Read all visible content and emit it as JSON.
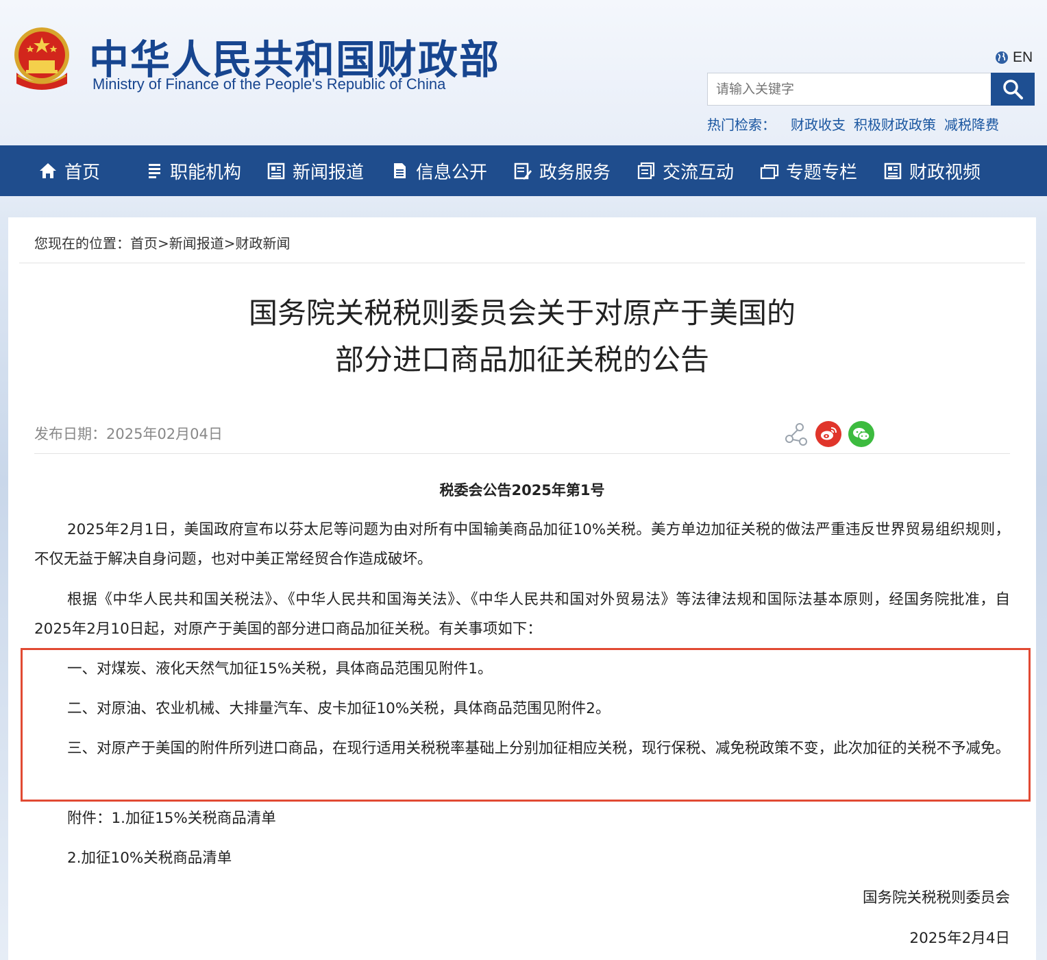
{
  "header": {
    "title_cn": "中华人民共和国财政部",
    "title_en": "Ministry of Finance of the People's Republic of China",
    "lang_label": "EN",
    "search_placeholder": "请输入关键字",
    "hot_label": "热门检索：",
    "hot_items": [
      "财政收支",
      "积极财政政策",
      "减税降费"
    ]
  },
  "nav": {
    "items": [
      {
        "label": "首页",
        "icon": "home-icon"
      },
      {
        "label": "职能机构",
        "icon": "list-icon"
      },
      {
        "label": "新闻报道",
        "icon": "news-icon"
      },
      {
        "label": "信息公开",
        "icon": "document-icon"
      },
      {
        "label": "政务服务",
        "icon": "edit-icon"
      },
      {
        "label": "交流互动",
        "icon": "chat-icon"
      },
      {
        "label": "专题专栏",
        "icon": "window-icon"
      },
      {
        "label": "财政视频",
        "icon": "video-icon"
      }
    ]
  },
  "breadcrumb": {
    "prefix": "您现在的位置：",
    "items": [
      "首页",
      "新闻报道",
      "财政新闻"
    ],
    "sep": ">"
  },
  "article": {
    "title_line1": "国务院关税税则委员会关于对原产于美国的",
    "title_line2": "部分进口商品加征关税的公告",
    "pubdate": "发布日期：2025年02月04日",
    "doc_no": "税委会公告2025年第1号",
    "p1": "2025年2月1日，美国政府宣布以芬太尼等问题为由对所有中国输美商品加征10%关税。美方单边加征关税的做法严重违反世界贸易组织规则，不仅无益于解决自身问题，也对中美正常经贸合作造成破坏。",
    "p2": "根据《中华人民共和国关税法》、《中华人民共和国海关法》、《中华人民共和国对外贸易法》等法律法规和国际法基本原则，经国务院批准，自2025年2月10日起，对原产于美国的部分进口商品加征关税。有关事项如下：",
    "item1": "一、对煤炭、液化天然气加征15%关税，具体商品范围见附件1。",
    "item2": "二、对原油、农业机械、大排量汽车、皮卡加征10%关税，具体商品范围见附件2。",
    "item3": "三、对原产于美国的附件所列进口商品，在现行适用关税税率基础上分别加征相应关税，现行保税、减免税政策不变，此次加征的关税不予减免。",
    "attach1": "附件：1.加征15%关税商品清单",
    "attach2": "2.加征10%关税商品清单",
    "signer": "国务院关税税则委员会",
    "sign_date": "2025年2月4日"
  },
  "colors": {
    "brand_blue": "#1f4d8d",
    "title_blue": "#17458f",
    "highlight_red": "#e14a33",
    "weibo_red": "#e0352b",
    "wechat_green": "#3dbb3f"
  }
}
